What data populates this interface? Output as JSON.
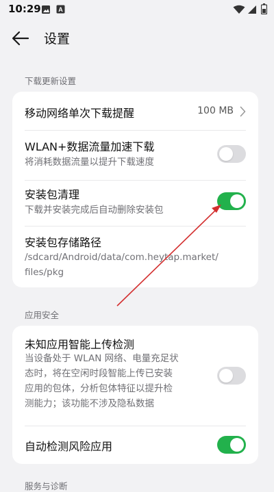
{
  "status_bar": {
    "time": "10:29",
    "icons": [
      "image-icon",
      "a-box-icon",
      "wifi-icon",
      "signal-icon",
      "battery-icon"
    ]
  },
  "app_bar": {
    "title": "设置",
    "back_icon": "back-arrow-icon"
  },
  "sections": {
    "download": {
      "header": "下载更新设置",
      "items": [
        {
          "title": "移动网络单次下载提醒",
          "value": "100 MB",
          "icon": "chevron-right-icon"
        },
        {
          "title": "WLAN+数据流量加速下载",
          "subtitle": "将消耗数据流量以提升下载速度",
          "toggle": "off"
        },
        {
          "title": "安装包清理",
          "subtitle": "下载并安装完成后自动删除安装包",
          "toggle": "on"
        },
        {
          "title": "安装包存储路径",
          "subtitle_line1": "/sdcard/Android/data/com.heytap.market/",
          "subtitle_line2": "files/pkg"
        }
      ]
    },
    "security": {
      "header": "应用安全",
      "items": [
        {
          "title": "未知应用智能上传检测",
          "subtitle_lines": [
            "当设备处于 WLAN 网络、电量充足状",
            "态时，将在空闲时段智能上传已安装",
            "应用的包体，分析包体特征以提升检",
            "测能力；该功能不涉及隐私数据"
          ],
          "toggle": "off"
        },
        {
          "title": "自动检测风险应用",
          "toggle": "on"
        }
      ]
    },
    "next_partial": {
      "header": "服务与诊断"
    }
  },
  "colors": {
    "background": "#f2f2f4",
    "card": "#ffffff",
    "toggle_on": "#22b14c",
    "toggle_off": "#dcdcdf",
    "annotation_arrow": "#d32f2f"
  }
}
